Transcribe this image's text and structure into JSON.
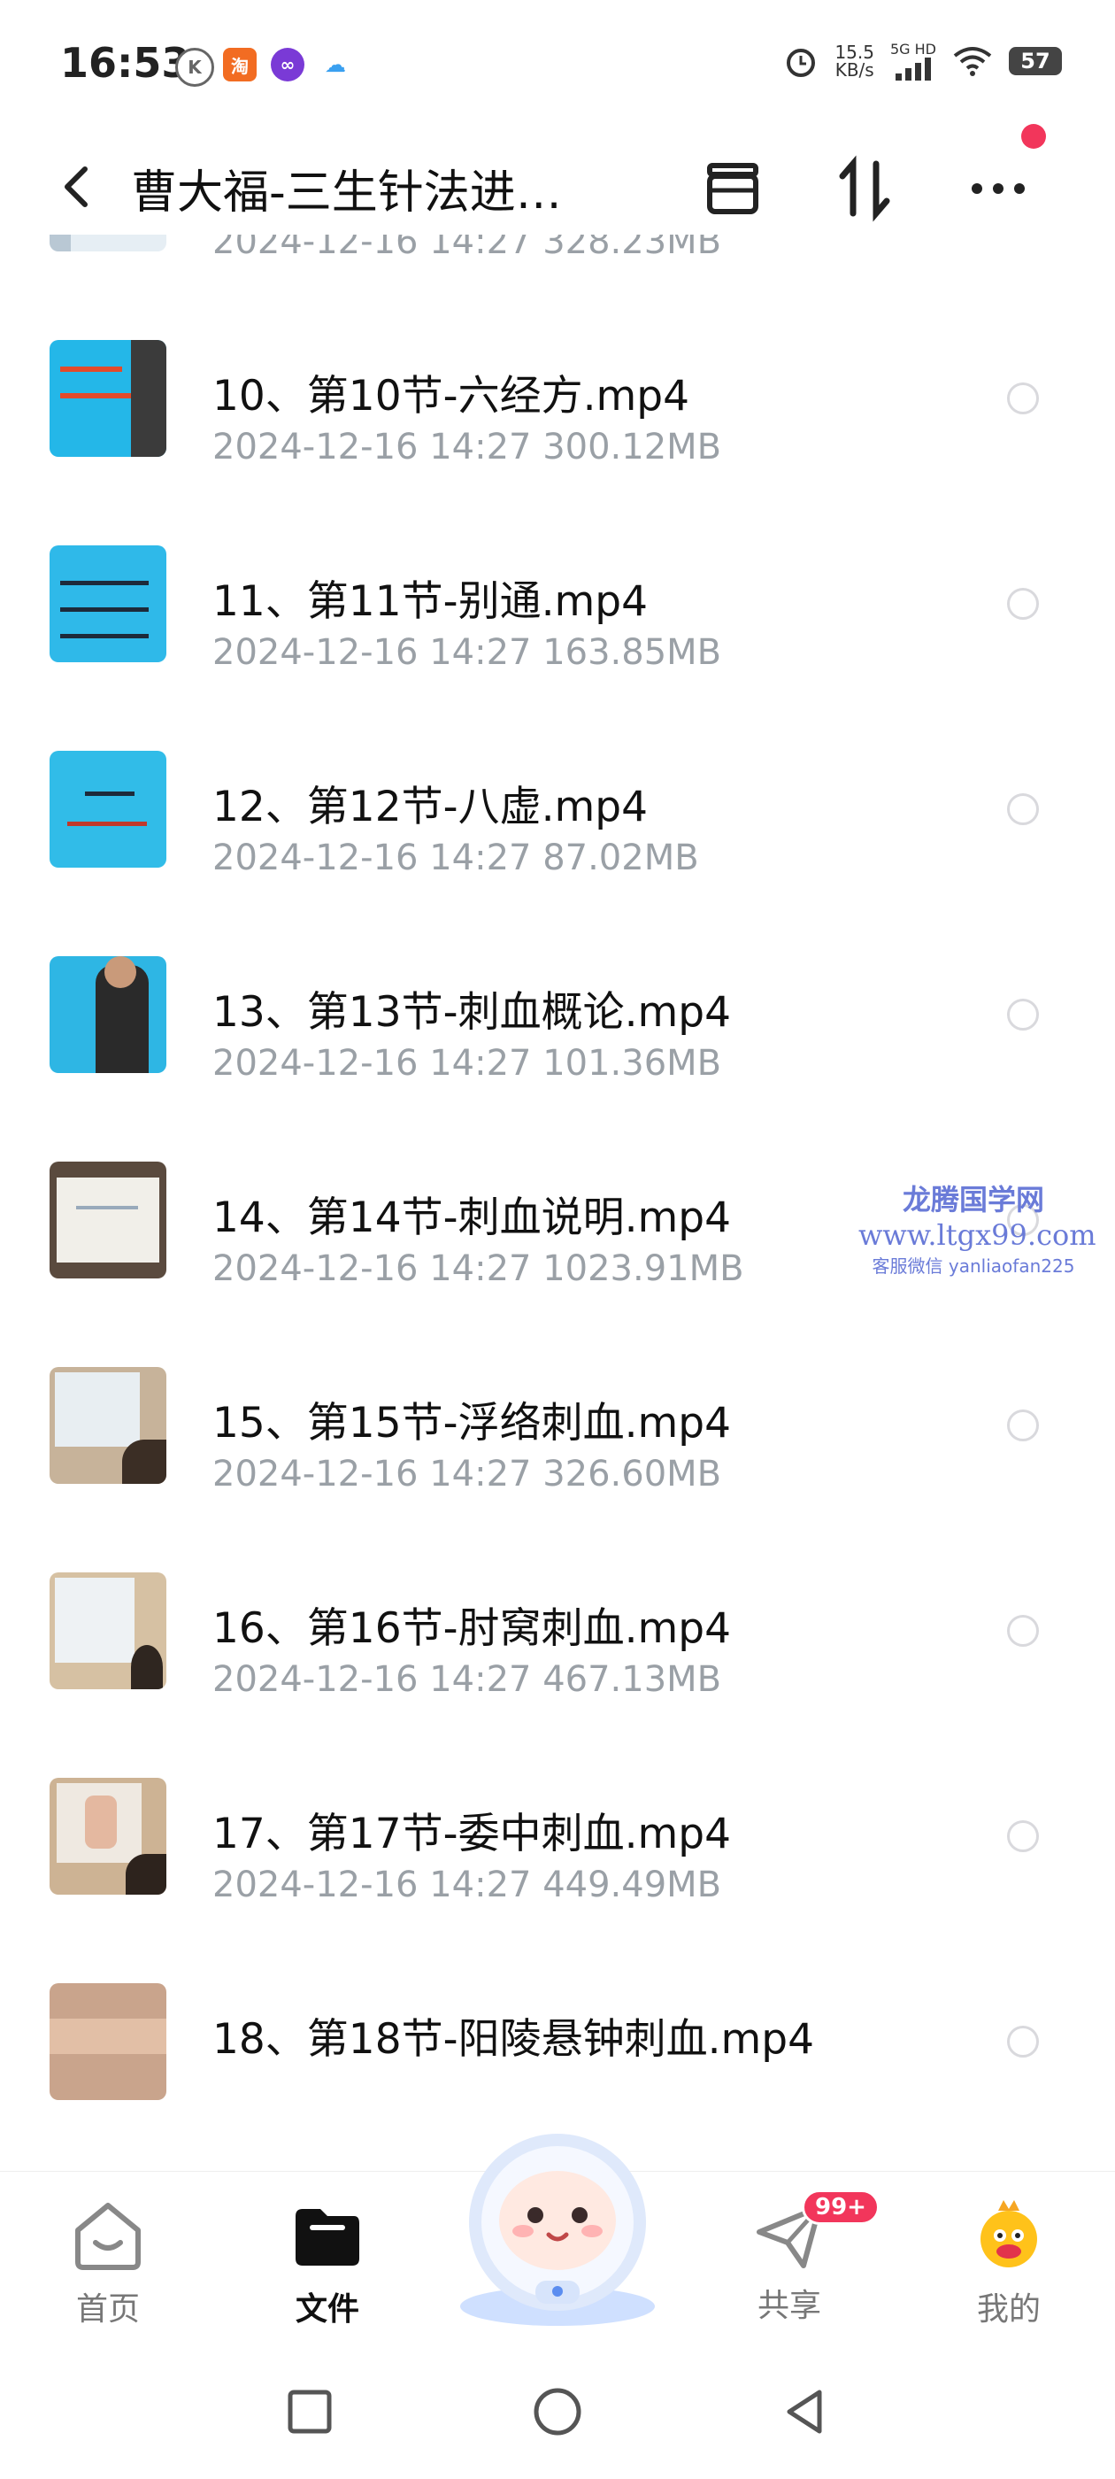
{
  "status_bar": {
    "time": "16:53",
    "net_speed_value": "15.5",
    "net_speed_unit": "KB/s",
    "network": "5G HD",
    "battery": "57",
    "app_icons": [
      "k-circle-icon",
      "taobao-icon",
      "infinity-app-icon",
      "cloud-app-icon"
    ]
  },
  "header": {
    "title": "曹大福-三生针法进…",
    "icons": [
      "back-icon",
      "archive-icon",
      "sort-icon",
      "more-icon"
    ]
  },
  "files": [
    {
      "name": "",
      "date": "2024-12-16",
      "time": "14:27",
      "size": "328.23MB",
      "thumb": "#e6eef4"
    },
    {
      "name": "10、第10节-六经方.mp4",
      "date": "2024-12-16",
      "time": "14:27",
      "size": "300.12MB",
      "thumb": "#24b7e8"
    },
    {
      "name": "11、第11节-别通.mp4",
      "date": "2024-12-16",
      "time": "14:27",
      "size": "163.85MB",
      "thumb": "#2fb9e9"
    },
    {
      "name": "12、第12节-八虚.mp4",
      "date": "2024-12-16",
      "time": "14:27",
      "size": "87.02MB",
      "thumb": "#31bce8"
    },
    {
      "name": "13、第13节-刺血概论.mp4",
      "date": "2024-12-16",
      "time": "14:27",
      "size": "101.36MB",
      "thumb": "#2eb6e4"
    },
    {
      "name": "14、第14节-刺血说明.mp4",
      "date": "2024-12-16",
      "time": "14:27",
      "size": "1023.91MB",
      "thumb": "#e9e6e0"
    },
    {
      "name": "15、第15节-浮络刺血.mp4",
      "date": "2024-12-16",
      "time": "14:27",
      "size": "326.60MB",
      "thumb": "#c7b39a"
    },
    {
      "name": "16、第16节-肘窝刺血.mp4",
      "date": "2024-12-16",
      "time": "14:27",
      "size": "467.13MB",
      "thumb": "#d6c1a3"
    },
    {
      "name": "17、第17节-委中刺血.mp4",
      "date": "2024-12-16",
      "time": "14:27",
      "size": "449.49MB",
      "thumb": "#cdb394"
    },
    {
      "name": "18、第18节-阳陵悬钟刺血.mp4",
      "date": "",
      "time": "",
      "size": "",
      "thumb": "#c9a48c"
    }
  ],
  "watermark": {
    "line1": "龙腾国学网",
    "line2": "www.ltgx99.com",
    "line3": "客服微信 yanliaofan225"
  },
  "bottom_nav": [
    {
      "label": "首页",
      "icon": "home-icon",
      "active": false
    },
    {
      "label": "文件",
      "icon": "folder-icon",
      "active": true
    },
    {
      "label": "共享",
      "icon": "share-plane-icon",
      "active": false,
      "badge": "99+"
    },
    {
      "label": "我的",
      "icon": "profile-mascot-icon",
      "active": false
    }
  ],
  "colors": {
    "accent_red": "#f2365b",
    "meta_gray": "#9aa0a6",
    "watermark": "#6a7bd8"
  }
}
